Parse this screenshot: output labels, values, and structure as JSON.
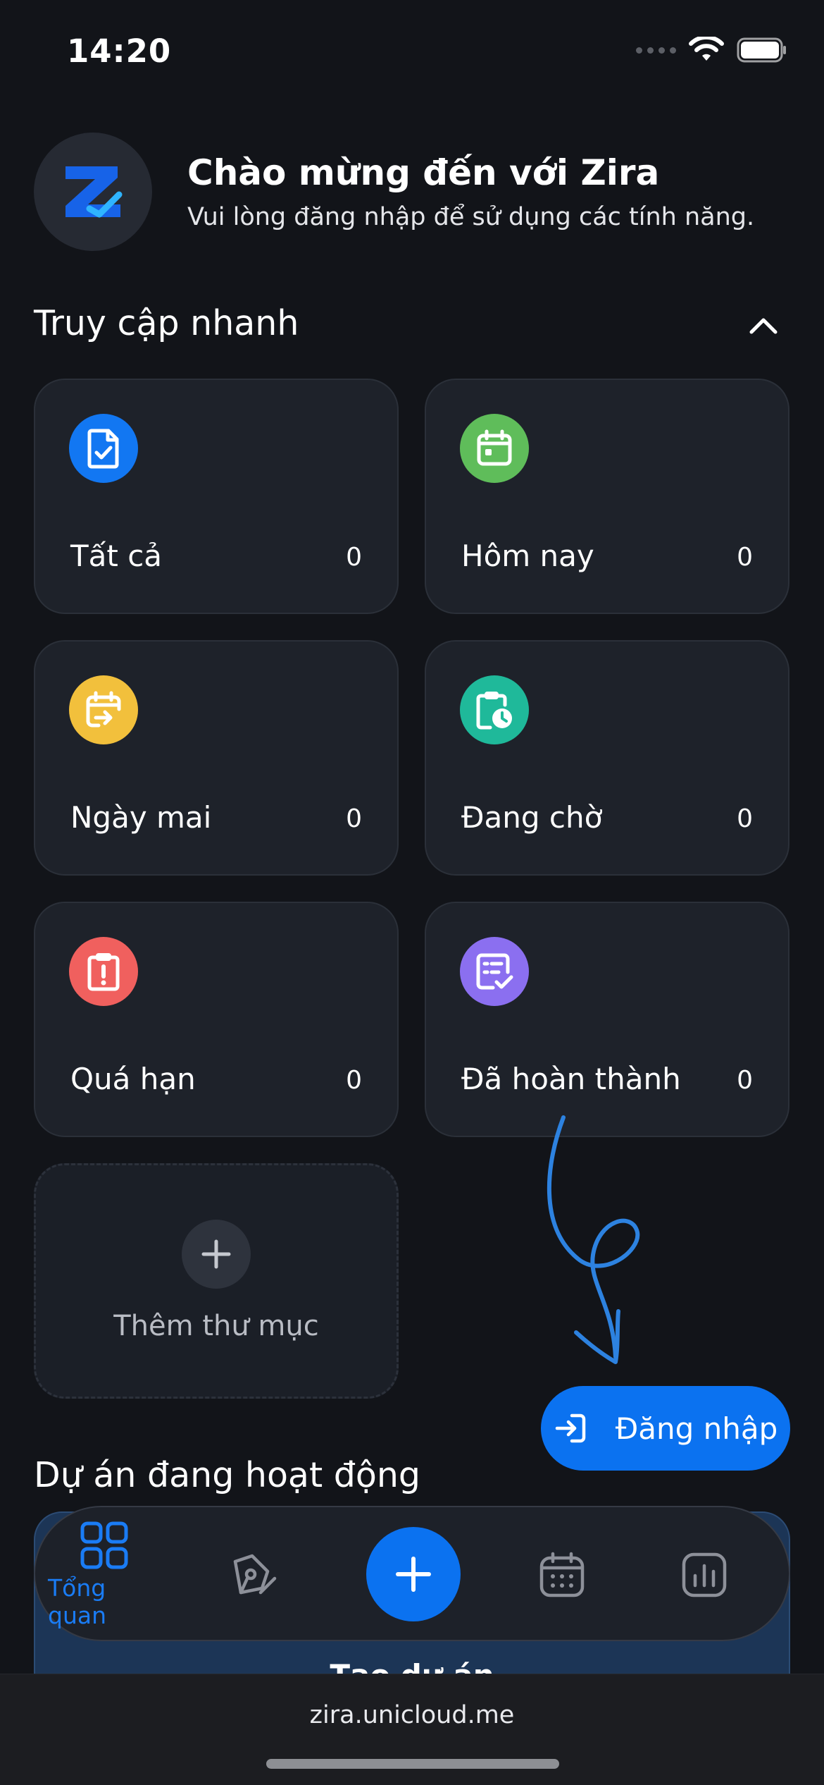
{
  "status_bar": {
    "time": "14:20"
  },
  "header": {
    "title": "Chào mừng đến với Zira",
    "subtitle": "Vui lòng đăng nhập để sử dụng các tính năng."
  },
  "quick_access": {
    "title": "Truy cập nhanh",
    "cards": [
      {
        "label": "Tất cả",
        "count": "0",
        "icon": "document-check-icon",
        "color": "#1277f2"
      },
      {
        "label": "Hôm nay",
        "count": "0",
        "icon": "calendar-today-icon",
        "color": "#5fbd5a"
      },
      {
        "label": "Ngày mai",
        "count": "0",
        "icon": "calendar-arrow-icon",
        "color": "#f2c03c"
      },
      {
        "label": "Đang chờ",
        "count": "0",
        "icon": "clipboard-clock-icon",
        "color": "#1fb99a"
      },
      {
        "label": "Quá hạn",
        "count": "0",
        "icon": "clipboard-alert-icon",
        "color": "#f0605e"
      },
      {
        "label": "Đã hoàn thành",
        "count": "0",
        "icon": "checklist-done-icon",
        "color": "#8b6ff0"
      }
    ],
    "add_folder_label": "Thêm thư mục"
  },
  "login_button_label": "Đăng nhập",
  "active_projects": {
    "title": "Dự án đang hoạt động",
    "create_label": "Tạo dự án"
  },
  "tab_bar": {
    "active_label": "Tổng quan",
    "accent": "#1a7cf5"
  },
  "browser": {
    "url": "zira.unicloud.me"
  }
}
